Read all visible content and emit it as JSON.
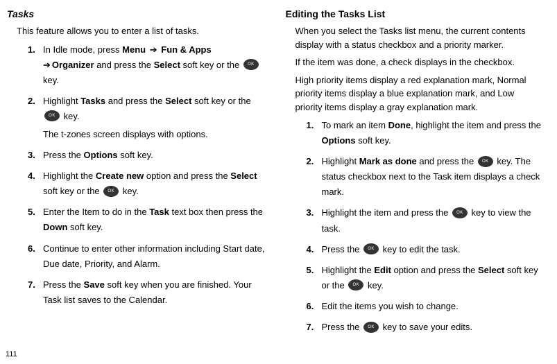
{
  "page_number": "111",
  "left": {
    "title": "Tasks",
    "intro": "This feature allows you to enter a list of tasks.",
    "steps": [
      {
        "num": "1.",
        "pre": "In Idle mode, press ",
        "b1": "Menu",
        "arrow1": " ➔ ",
        "b2": "Fun & Apps",
        "arrow2": " ➔",
        "b3": "Organizer",
        "post1": " and press the ",
        "b4": "Select",
        "post2": " soft key or the ",
        "post3": " key."
      },
      {
        "num": "2.",
        "pre": "Highlight ",
        "b1": "Tasks",
        "mid": " and press the ",
        "b2": "Select",
        "post1": " soft key or the ",
        "post2": " key.",
        "sub": "The t-zones screen displays with options."
      },
      {
        "num": "3.",
        "pre": "Press the ",
        "b1": "Options",
        "post": " soft key."
      },
      {
        "num": "4.",
        "pre": "Highlight the ",
        "b1": "Create new",
        "mid": " option and press the ",
        "b2": "Select",
        "post1": " soft key or the ",
        "post2": " key."
      },
      {
        "num": "5.",
        "pre": "Enter the Item to do in the ",
        "b1": "Task",
        "mid": " text box then press the ",
        "b2": "Down",
        "post": " soft key."
      },
      {
        "num": "6.",
        "text": "Continue to enter other information including Start date, Due date, Priority, and Alarm."
      },
      {
        "num": "7.",
        "pre": "Press the ",
        "b1": "Save",
        "post": " soft key when you are finished. Your Task list saves to the Calendar."
      }
    ]
  },
  "right": {
    "title": "Editing the Tasks List",
    "p1": "When you select the Tasks list menu, the current contents display with a status checkbox and a priority marker.",
    "p2": "If the item was done, a check displays in the checkbox.",
    "p3": "High priority items display a red explanation mark, Normal priority items display a blue explanation mark, and Low priority items display a gray explanation mark.",
    "steps": [
      {
        "num": "1.",
        "pre": "To mark an item ",
        "b1": "Done",
        "mid": ", highlight the item and press the ",
        "b2": "Options",
        "post": " soft key."
      },
      {
        "num": "2.",
        "pre": "Highlight ",
        "b1": "Mark as done",
        "mid": " and press the ",
        "post1": " key. The status checkbox next to the Task item displays a check mark."
      },
      {
        "num": "3.",
        "pre": "Highlight the item and press the ",
        "post": " key to view the task."
      },
      {
        "num": "4.",
        "pre": "Press the ",
        "post": " key to edit the task."
      },
      {
        "num": "5.",
        "pre": "Highlight the ",
        "b1": "Edit",
        "mid": " option and press the ",
        "b2": "Select",
        "post1": " soft key or the ",
        "post2": " key."
      },
      {
        "num": "6.",
        "text": "Edit the items you wish to change."
      },
      {
        "num": "7.",
        "pre": "Press the ",
        "post": " key to save your edits."
      }
    ]
  },
  "ok_label": "OK"
}
